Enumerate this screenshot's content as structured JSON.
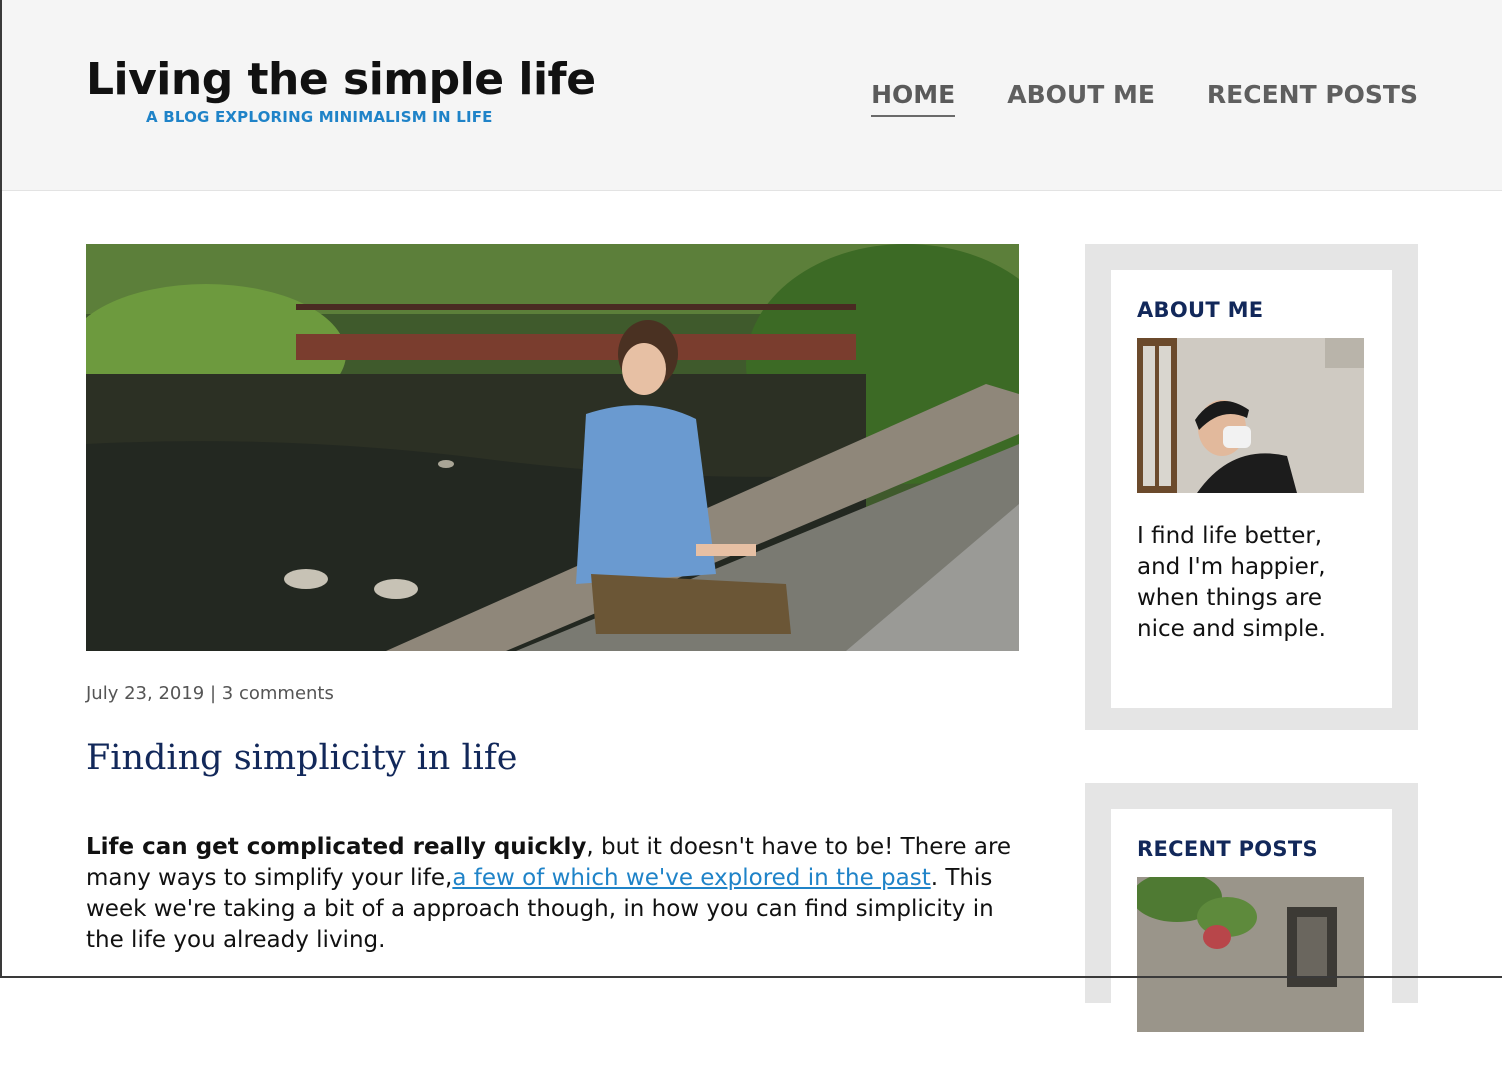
{
  "site": {
    "title": "Living the simple life",
    "tagline": "A BLOG EXPLORING MINIMALISM IN LIFE"
  },
  "nav": {
    "items": [
      {
        "label": "HOME",
        "active": true
      },
      {
        "label": "ABOUT ME",
        "active": false
      },
      {
        "label": "RECENT POSTS",
        "active": false
      }
    ]
  },
  "post": {
    "date": "July 23, 2019",
    "separator": "|",
    "comments": "3 comments",
    "title": "Finding simplicity in life",
    "body_bold": "Life can get complicated really quickly",
    "body_part1": ", but it doesn't have to be! There are many ways to simplify your life,",
    "body_link": "a few of which we've explored in the past",
    "body_part2": ". This week we're taking a bit of a approach though, in how you can find simplicity in the life you already living."
  },
  "sidebar": {
    "about": {
      "heading": "ABOUT ME",
      "text": "I find life better, and I'm happier, when things are nice and simple."
    },
    "recent": {
      "heading": "RECENT POSTS"
    }
  },
  "colors": {
    "header_bg": "#f5f5f5",
    "accent_blue": "#1f83c8",
    "heading_navy": "#12285a",
    "nav_gray": "#5f5f5f",
    "sidebar_bg": "#e5e5e5"
  }
}
